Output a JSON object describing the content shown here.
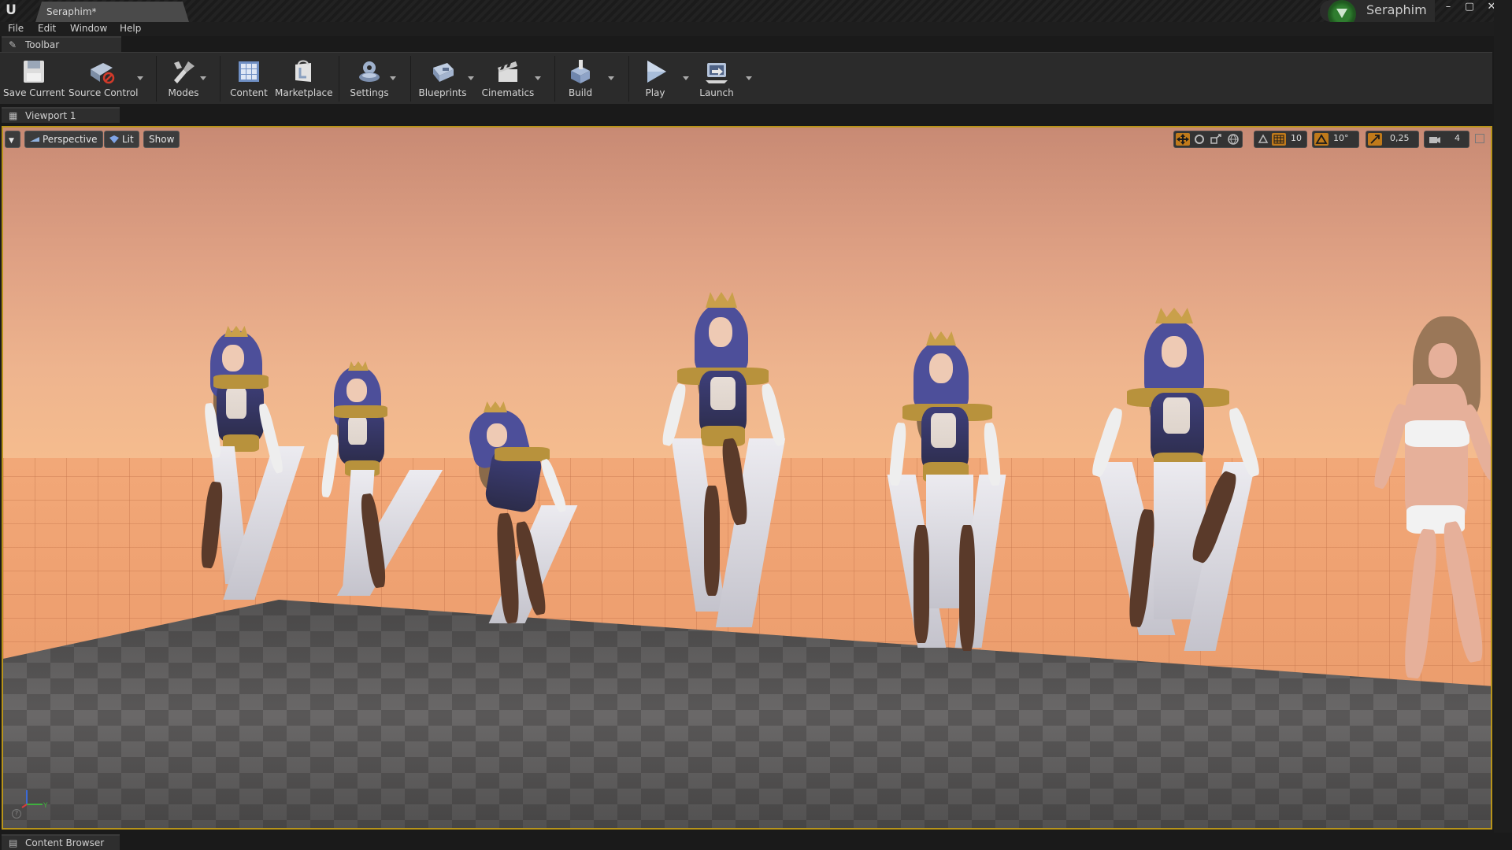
{
  "window": {
    "document_tab": "Seraphim*",
    "user_name": "Seraphim",
    "logo": "ue-logo-icon",
    "controls": [
      "minimize-icon",
      "restore-icon",
      "close-icon"
    ]
  },
  "menu": [
    "File",
    "Edit",
    "Window",
    "Help"
  ],
  "toolbar_panel": {
    "tab_label": "Toolbar"
  },
  "toolbar": [
    {
      "label": "Save Current",
      "icon": "save-icon"
    },
    {
      "label": "Source Control",
      "icon": "source-control-icon"
    },
    {
      "label": "Modes",
      "icon": "modes-icon"
    },
    {
      "label": "Content",
      "icon": "content-icon"
    },
    {
      "label": "Marketplace",
      "icon": "marketplace-icon"
    },
    {
      "label": "Settings",
      "icon": "settings-icon"
    },
    {
      "label": "Blueprints",
      "icon": "blueprints-icon"
    },
    {
      "label": "Cinematics",
      "icon": "cinematics-icon"
    },
    {
      "label": "Build",
      "icon": "build-icon"
    },
    {
      "label": "Play",
      "icon": "play-icon"
    },
    {
      "label": "Launch",
      "icon": "launch-icon"
    }
  ],
  "viewport": {
    "tab_label": "Viewport 1",
    "perspective_label": "Perspective",
    "lit_label": "Lit",
    "show_label": "Show",
    "grid_snap": "10",
    "rotation_snap": "10°",
    "scale_snap": "0,25",
    "camera_speed": "4"
  },
  "bottom_panel": {
    "tab_label": "Content Browser"
  },
  "colors": {
    "accent_border": "#b8941a",
    "sky": "#dfa184",
    "floor": "#f2a878",
    "platform": "#5a5858",
    "outfit_blue": "#4d4f9a",
    "outfit_gold": "#b8923c"
  }
}
